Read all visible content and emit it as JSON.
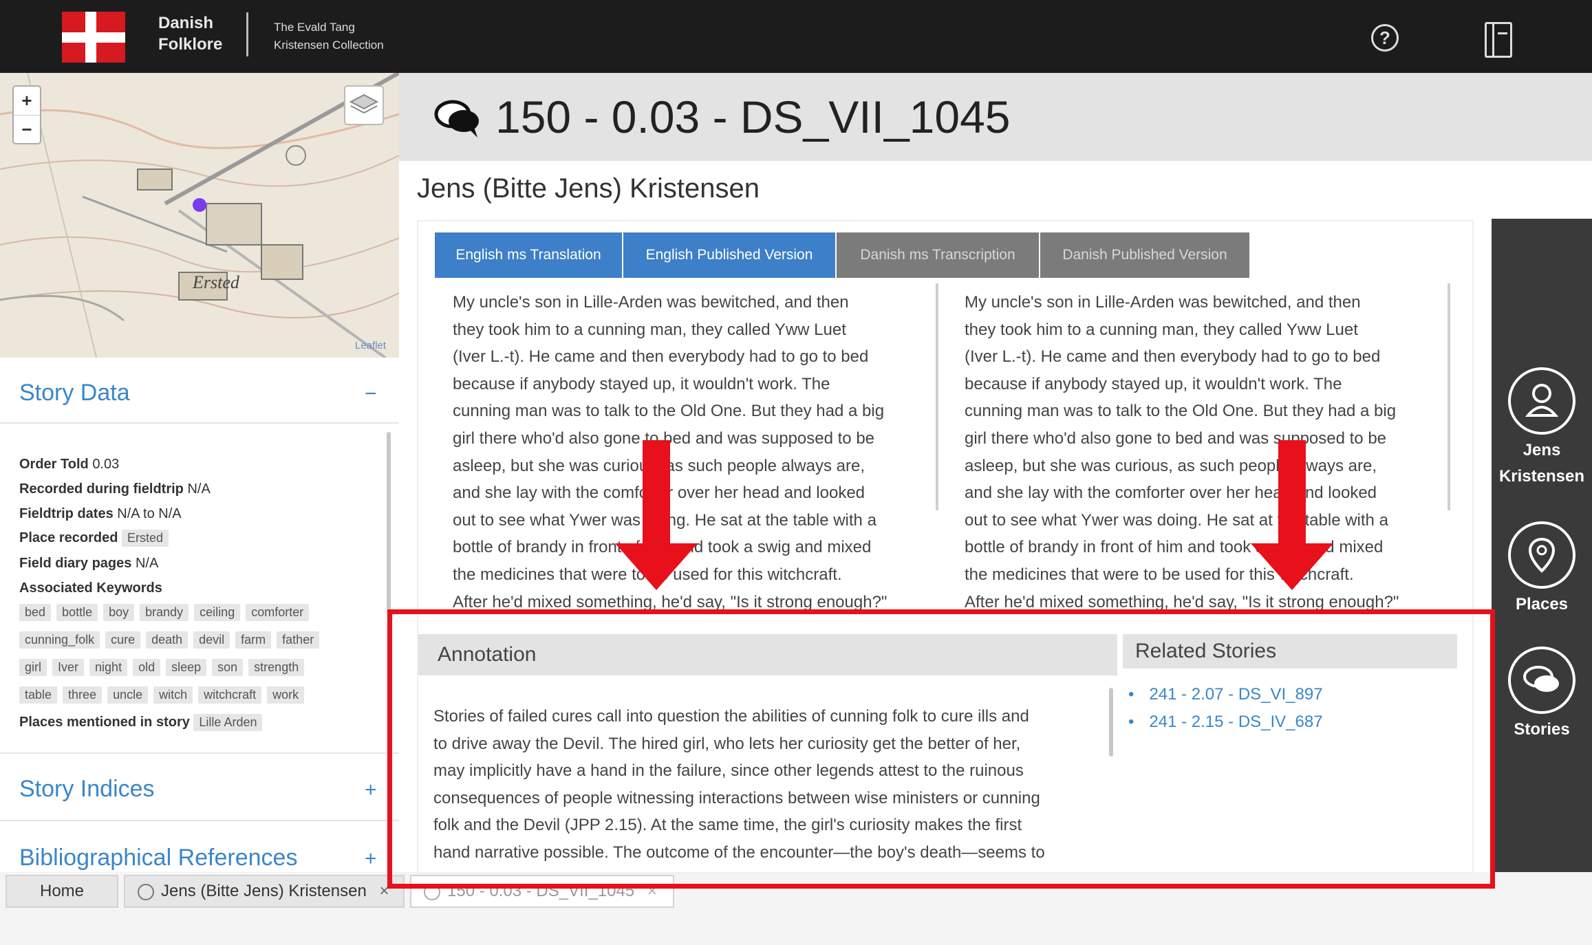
{
  "header": {
    "brand_line1": "Danish",
    "brand_line2": "Folklore",
    "sub_line1": "The Evald Tang",
    "sub_line2": "Kristensen Collection",
    "help_icon": "help-icon",
    "book_icon": "book-icon"
  },
  "map": {
    "zoom_in": "+",
    "zoom_out": "−",
    "credit": "Leaflet",
    "town_label": "Ersted"
  },
  "sidebar": {
    "story_data_title": "Story Data",
    "story_data_sign": "−",
    "order_told_label": "Order Told",
    "order_told_value": "0.03",
    "recorded_label": "Recorded during fieldtrip",
    "recorded_value": "N/A",
    "fieldtrip_label": "Fieldtrip dates",
    "fieldtrip_value": "N/A to N/A",
    "place_label": "Place recorded",
    "place_value": "Ersted",
    "diary_label": "Field diary pages",
    "diary_value": "N/A",
    "keywords_label": "Associated Keywords",
    "keywords_row1": [
      "bed",
      "bottle",
      "boy",
      "brandy",
      "ceiling",
      "comforter"
    ],
    "keywords_row2": [
      "cunning_folk",
      "cure",
      "death",
      "devil",
      "farm",
      "father"
    ],
    "keywords_row3": [
      "girl",
      "Iver",
      "night",
      "old",
      "sleep",
      "son",
      "strength"
    ],
    "keywords_row4": [
      "table",
      "three",
      "uncle",
      "witch",
      "witchcraft",
      "work"
    ],
    "places_label": "Places mentioned in story",
    "places_value": "Lille Arden",
    "indices_title": "Story Indices",
    "indices_sign": "+",
    "biblio_title": "Bibliographical References",
    "biblio_sign": "+"
  },
  "bottom_tabs": {
    "home": "Home",
    "person": "Jens (Bitte Jens) Kristensen",
    "story": "150 - 0.03 - DS_VII_1045",
    "close": "×"
  },
  "story": {
    "title": "150 - 0.03 - DS_VII_1045",
    "teller": "Jens (Bitte Jens) Kristensen",
    "tabs": [
      "English ms Translation",
      "English Published Version",
      "Danish ms Transcription",
      "Danish Published Version"
    ],
    "left_lines": [
      "My uncle's son in Lille-Arden was bewitched, and then",
      "they took him to a cunning man, they called Yww Luet",
      "(Iver L.-t). He came and then everybody had to go to bed",
      "because if anybody stayed up, it wouldn't work. The",
      "cunning man was to talk to the Old One. But they had a big",
      "girl there who'd also gone to bed and was supposed to be",
      "asleep, but she was curious, as such people always are,",
      "and she lay with the comforter over her head and looked",
      "out to see what Ywer was doing. He sat at the table with a",
      "bottle of brandy in front of him and took a swig and mixed",
      "the medicines that were to be used for this witchcraft.",
      "After he'd mixed something, he'd say, \"Is it strong enough?\""
    ],
    "right_lines": [
      "My uncle's son in Lille-Arden was bewitched, and then",
      "they took him to a cunning man, they called Yww Luet",
      "(Iver L.-t). He came and then everybody had to go to bed",
      "because if anybody stayed up, it wouldn't work. The",
      "cunning man was to talk to the Old One. But they had a big",
      "girl there who'd also gone to bed and was supposed to be",
      "asleep, but she was curious, as such people always are,",
      "and she lay with the comforter over her head and looked",
      "out to see what Ywer was doing. He sat at the table with a",
      "bottle of brandy in front of him and took a swig and mixed",
      "the medicines that were to be used for this witchcraft.",
      "After he'd mixed something, he'd say, \"Is it strong enough?\""
    ]
  },
  "annotation": {
    "title": "Annotation",
    "lines": [
      "Stories of failed cures call into question the abilities of cunning folk to cure ills and",
      "to drive away the Devil. The hired girl, who lets her curiosity get the better of her,",
      "may implicitly have a hand in the failure, since other legends attest to the ruinous",
      "consequences of people witnessing interactions between wise ministers or cunning",
      "folk and the Devil (JPP 2.15). At the same time, the girl's curiosity makes the first",
      "hand narrative possible. The outcome of the encounter—the boy's death—seems to"
    ]
  },
  "related": {
    "title": "Related Stories",
    "items": [
      "241 - 2.07 - DS_VI_897",
      "241 - 2.15 - DS_IV_687"
    ]
  },
  "right_nav": {
    "person_line1": "Jens",
    "person_line2": "Kristensen",
    "places": "Places",
    "stories": "Stories"
  },
  "colors": {
    "accent_blue": "#3d7fc8",
    "highlight_red": "#e8101a",
    "topbar": "#1c1c1c"
  }
}
